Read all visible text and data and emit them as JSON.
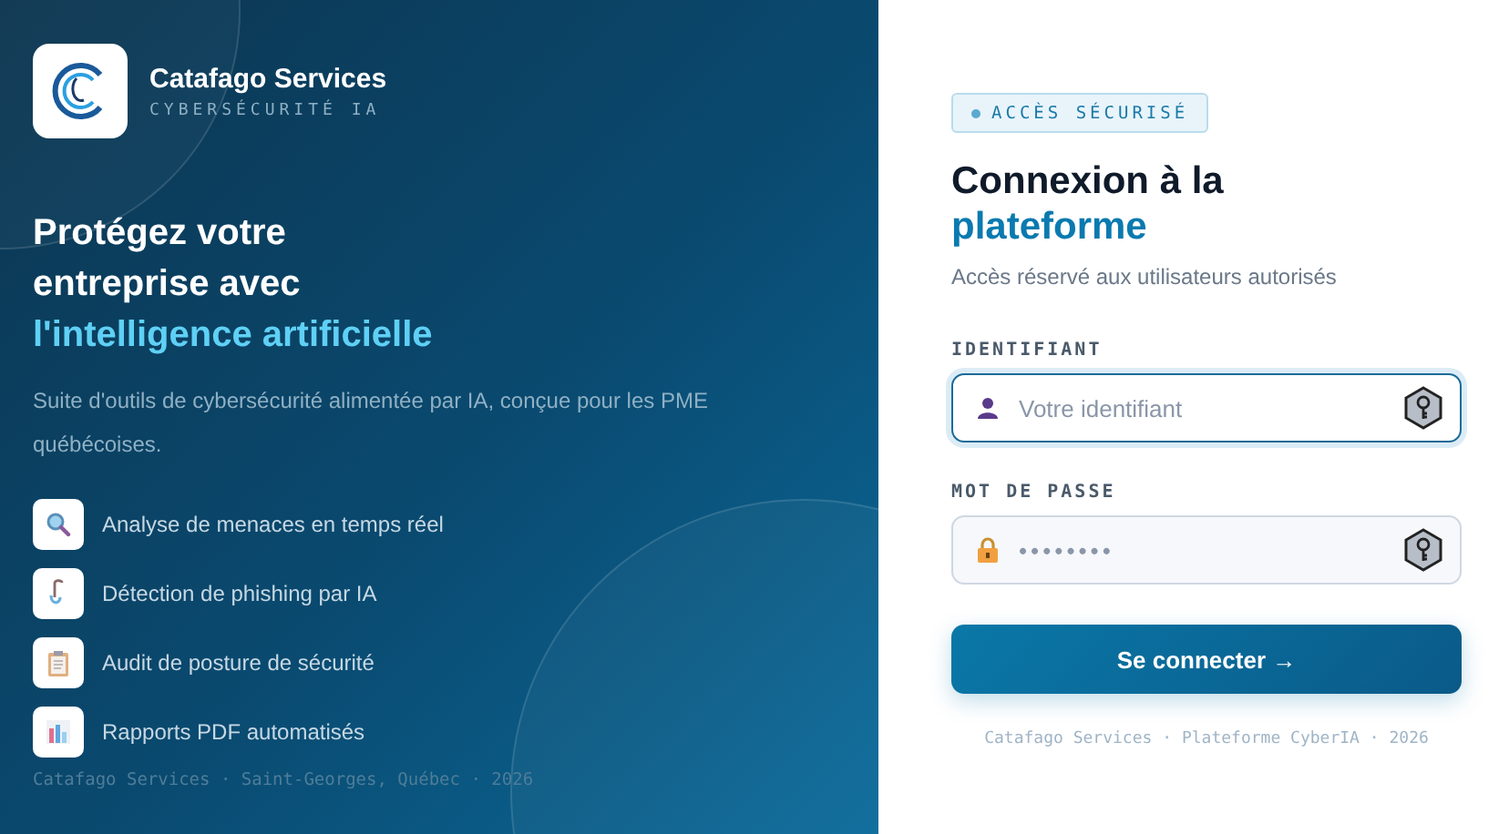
{
  "brand": {
    "name": "Catafago Services",
    "tagline": "CYBERSÉCURITÉ IA"
  },
  "hero": {
    "headline_lines": [
      "Protégez votre",
      "entreprise avec"
    ],
    "headline_accent": "l'intelligence artificielle",
    "description": "Suite d'outils de cybersécurité alimentée par IA, conçue pour les PME québécoises."
  },
  "features": [
    {
      "kind": "search",
      "label": "Analyse de menaces en temps réel"
    },
    {
      "kind": "phishing",
      "label": "Détection de phishing par IA"
    },
    {
      "kind": "clipboard",
      "label": "Audit de posture de sécurité"
    },
    {
      "kind": "chart",
      "label": "Rapports PDF automatisés"
    }
  ],
  "left_footer": "Catafago Services · Saint-Georges, Québec · 2026",
  "badge": "ACCÈS SÉCURISÉ",
  "title": {
    "line": "Connexion à la",
    "accent": "plateforme"
  },
  "subtitle": "Accès réservé aux utilisateurs autorisés",
  "fields": [
    {
      "kind": "user",
      "label": "IDENTIFIANT",
      "placeholder": "Votre identifiant",
      "focused": true
    },
    {
      "kind": "password",
      "label": "MOT DE PASSE",
      "placeholder": "••••••••",
      "focused": false
    }
  ],
  "submit": "Se connecter →",
  "right_footer": "Catafago Services · Plateforme CyberIA · 2026"
}
